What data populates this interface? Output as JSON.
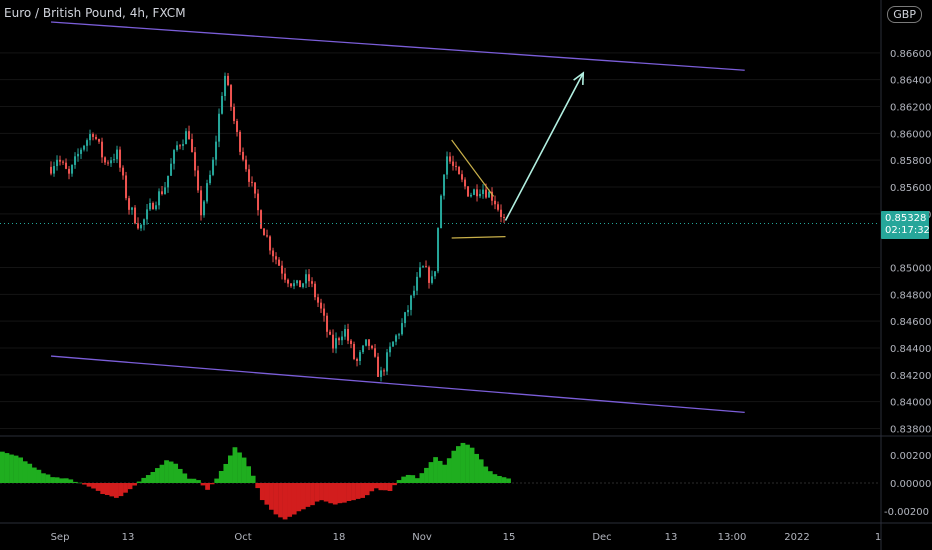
{
  "header": {
    "symbol_title": "Euro / British Pound, 4h, FXCM",
    "currency_badge": "GBP"
  },
  "price_tag": {
    "price": "0.85328",
    "countdown": "02:17:32"
  },
  "colors": {
    "up": "#26a69a",
    "down": "#ef5350",
    "channel": "#7b5ed9",
    "wedge": "#c9b04a",
    "arrow": "#b2f0e1",
    "osc_up": "#1fae1f",
    "osc_down": "#d21d1d",
    "background": "#000000"
  },
  "chart_data": [
    {
      "type": "candlestick",
      "title": "Euro / British Pound, 4h, FXCM",
      "ylim": [
        0.8376,
        0.8688
      ],
      "y_ticks": [
        "0.86600",
        "0.86400",
        "0.86200",
        "0.86000",
        "0.85800",
        "0.85600",
        "0.85400",
        "0.85000",
        "0.84800",
        "0.84600",
        "0.84400",
        "0.84200",
        "0.84000",
        "0.83800"
      ],
      "y_tick_values": [
        0.866,
        0.864,
        0.862,
        0.86,
        0.858,
        0.856,
        0.854,
        0.85,
        0.848,
        0.846,
        0.844,
        0.842,
        0.84,
        0.838
      ],
      "x_ticks": [
        "Sep",
        "13",
        "Oct",
        "18",
        "Nov",
        "15",
        "Dec",
        "13",
        "13:00",
        "2022",
        "1"
      ],
      "last_price": 0.85328,
      "price_path": [
        [
          "Aug 30",
          0.8575
        ],
        [
          "Sep 1",
          0.8582
        ],
        [
          "Sep 3",
          0.8568
        ],
        [
          "Sep 5",
          0.8589
        ],
        [
          "Sep 7",
          0.8602
        ],
        [
          "Sep 9",
          0.8578
        ],
        [
          "Sep 11",
          0.8585
        ],
        [
          "Sep 13",
          0.8545
        ],
        [
          "Sep 15",
          0.853
        ],
        [
          "Sep 17",
          0.8548
        ],
        [
          "Sep 19",
          0.856
        ],
        [
          "Sep 21",
          0.859
        ],
        [
          "Sep 23",
          0.8602
        ],
        [
          "Sep 25",
          0.854
        ],
        [
          "Sep 27",
          0.8575
        ],
        [
          "Sep 29",
          0.8645
        ],
        [
          "Oct 1",
          0.86
        ],
        [
          "Oct 3",
          0.857
        ],
        [
          "Oct 5",
          0.8535
        ],
        [
          "Oct 7",
          0.8512
        ],
        [
          "Oct 9",
          0.8495
        ],
        [
          "Oct 11",
          0.8485
        ],
        [
          "Oct 13",
          0.8492
        ],
        [
          "Oct 15",
          0.847
        ],
        [
          "Oct 17",
          0.844
        ],
        [
          "Oct 19",
          0.8455
        ],
        [
          "Oct 21",
          0.8428
        ],
        [
          "Oct 23",
          0.8445
        ],
        [
          "Oct 25",
          0.8418
        ],
        [
          "Oct 27",
          0.8442
        ],
        [
          "Oct 29",
          0.846
        ],
        [
          "Nov 1",
          0.85
        ],
        [
          "Nov 3",
          0.8488
        ],
        [
          "Nov 4",
          0.8545
        ],
        [
          "Nov 5",
          0.8585
        ],
        [
          "Nov 7",
          0.8568
        ],
        [
          "Nov 9",
          0.8555
        ],
        [
          "Nov 11",
          0.856
        ],
        [
          "Nov 13",
          0.8552
        ],
        [
          "Nov 15",
          0.8533
        ]
      ],
      "drawings": {
        "channel_upper": [
          [
            "Aug 30",
            0.8683
          ],
          [
            "Dec 25",
            0.8647
          ]
        ],
        "channel_lower": [
          [
            "Aug 30",
            0.8434
          ],
          [
            "Dec 25",
            0.8392
          ]
        ],
        "wedge_upper": [
          [
            "Nov 6",
            0.8595
          ],
          [
            "Nov 13",
            0.8553
          ]
        ],
        "wedge_lower": [
          [
            "Nov 6",
            0.8522
          ],
          [
            "Nov 15",
            0.8523
          ]
        ],
        "projection_arrow": [
          [
            "Nov 15",
            0.8535
          ],
          [
            "Nov 28",
            0.8645
          ]
        ]
      }
    },
    {
      "type": "histogram",
      "ylim": [
        -0.0026,
        0.0028
      ],
      "y_ticks": [
        "0.00200",
        "0.00000",
        "-0.00200"
      ],
      "y_tick_values": [
        0.002,
        0.0,
        -0.002
      ],
      "profile": [
        [
          0,
          0.0022
        ],
        [
          4,
          0.0018
        ],
        [
          8,
          0.0009
        ],
        [
          11,
          0.0004
        ],
        [
          14,
          0.0003
        ],
        [
          17,
          5e-05
        ],
        [
          19,
          -0.0002
        ],
        [
          22,
          -0.0008
        ],
        [
          25,
          -0.0011
        ],
        [
          27,
          -0.0007
        ],
        [
          30,
          0.0001
        ],
        [
          33,
          0.0008
        ],
        [
          36,
          0.0016
        ],
        [
          38,
          0.0014
        ],
        [
          41,
          0.0003
        ],
        [
          43,
          0.0002
        ],
        [
          45,
          -0.0005
        ],
        [
          47,
          0.0003
        ],
        [
          49,
          0.0014
        ],
        [
          51,
          0.0026
        ],
        [
          53,
          0.0018
        ],
        [
          55,
          0.0005
        ],
        [
          57,
          -0.0012
        ],
        [
          60,
          -0.0022
        ],
        [
          62,
          -0.0026
        ],
        [
          64,
          -0.0022
        ],
        [
          67,
          -0.0017
        ],
        [
          70,
          -0.0012
        ],
        [
          73,
          -0.0015
        ],
        [
          76,
          -0.0013
        ],
        [
          79,
          -0.0011
        ],
        [
          82,
          -0.0004
        ],
        [
          85,
          -0.0006
        ],
        [
          87,
          0.0002
        ],
        [
          89,
          0.0006
        ],
        [
          91,
          0.0004
        ],
        [
          93,
          0.0011
        ],
        [
          95,
          0.0018
        ],
        [
          97,
          0.0013
        ],
        [
          99,
          0.0023
        ],
        [
          101,
          0.0029
        ],
        [
          103,
          0.0025
        ],
        [
          106,
          0.0012
        ],
        [
          108,
          0.0006
        ],
        [
          110,
          0.0004
        ],
        [
          111,
          0.0003
        ]
      ]
    }
  ]
}
